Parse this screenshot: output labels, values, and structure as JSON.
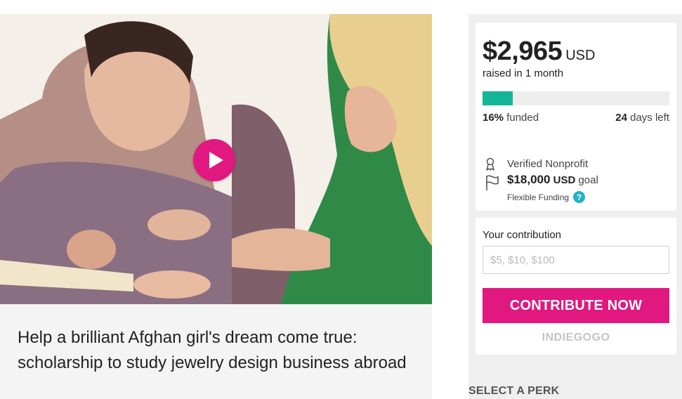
{
  "campaign": {
    "title": "Help a brilliant Afghan girl's dream come true: scholarship to study jewelry design business abroad"
  },
  "funding": {
    "amount": "$2,965",
    "currency": "USD",
    "raised_text": "raised in 1 month",
    "progress_fraction": 0.16,
    "percent_funded": "16%",
    "funded_label": "funded",
    "days_left_count": "24",
    "days_left_label": "days left",
    "verified_label": "Verified Nonprofit",
    "goal_amount": "$18,000",
    "goal_currency": "USD",
    "goal_label": "goal",
    "flexible_funding_label": "Flexible Funding",
    "help_symbol": "?"
  },
  "contribution": {
    "label": "Your contribution",
    "placeholder": "$5, $10, $100",
    "value": "",
    "button_label": "CONTRIBUTE NOW",
    "brand": "INDIEGOGO"
  },
  "perks": {
    "heading": "SELECT A PERK"
  },
  "icons": {
    "play": "play-icon",
    "verified": "ribbon-icon",
    "goal": "flag-icon",
    "help": "question-icon"
  },
  "colors": {
    "accent_pink": "#e0187f",
    "progress_teal": "#14b596",
    "help_blue": "#20b3c9",
    "sidebar_gray": "#efefef"
  }
}
